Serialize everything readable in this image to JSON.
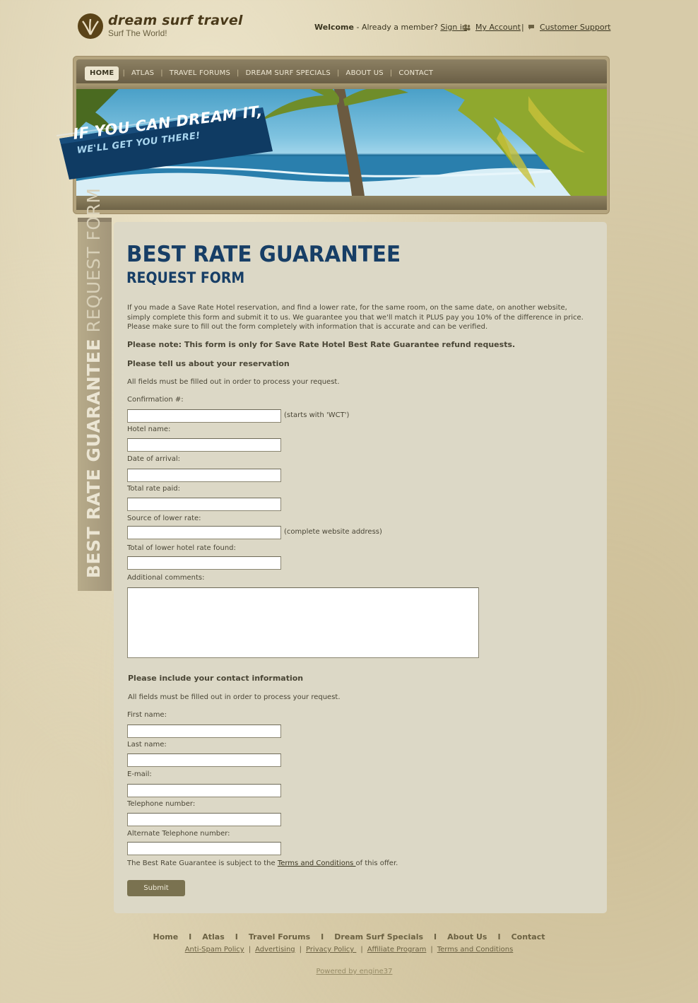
{
  "header": {
    "logo_name": "dream surf travel",
    "logo_tagline": "Surf The World!",
    "welcome_label": "Welcome",
    "welcome_text": " - Already a member? ",
    "sign_in": "Sign in",
    "my_account": "My Account",
    "separator": "|",
    "customer_support": "Customer Support"
  },
  "nav": {
    "items": [
      "HOME",
      "ATLAS",
      "TRAVEL FORUMS",
      "DREAM SURF SPECIALS",
      "ABOUT US",
      "CONTACT"
    ],
    "active": "HOME",
    "separator": "|"
  },
  "banner": {
    "slogan_line1": "IF YOU CAN DREAM IT,",
    "slogan_line2": "WE'LL GET YOU THERE!"
  },
  "sidetab": {
    "bold": "BEST RATE GUARANTEE",
    "light": " REQUEST FORM"
  },
  "page": {
    "title": "BEST RATE GUARANTEE",
    "subtitle": "REQUEST FORM",
    "intro": "If you made a Save Rate Hotel reservation, and find a lower rate, for the same room, on the same date, on another website, simply complete this form and submit it to us. We guarantee you that we'll match it PLUS pay you 10% of the difference in price. Please make sure to fill out the form completely with information that is accurate and can be verified.",
    "note": "Please note: This form is only for Save Rate Hotel Best Rate Guarantee refund requests.",
    "reservation_heading": "Please tell us about your reservation",
    "required_note": "All fields must be filled out in order to process your request.",
    "fields": {
      "confirmation": "Confirmation #:",
      "confirmation_hint": "(starts with 'WCT')",
      "hotel_name": "Hotel name:",
      "date_arrival": "Date of arrival:",
      "total_rate": "Total rate paid:",
      "source_lower": "Source of lower rate:",
      "source_hint": "(complete website address)",
      "total_lower": "Total of lower hotel rate found:",
      "comments": "Additional comments:"
    },
    "contact_heading": "Please include your contact information",
    "contact_required_note": "All fields must be filled out in order to process your request.",
    "contact_fields": {
      "first_name": "First name:",
      "last_name": "Last name:",
      "email": "E-mail:",
      "telephone": "Telephone number:",
      "alt_telephone": "Alternate Telephone number:"
    },
    "terms_pre": "The Best Rate Guarantee is subject to the ",
    "terms_link": "Terms and Conditions ",
    "terms_post": "of this offer.",
    "submit": "Submit"
  },
  "footer": {
    "nav": [
      "Home",
      "Atlas",
      "Travel Forums",
      "Dream Surf Specials",
      "About Us",
      "Contact"
    ],
    "nav_separator": "I",
    "links": [
      "Anti-Spam Policy",
      "Advertising",
      "Privacy Policy ",
      "Affiliate Program",
      "Terms and Conditions"
    ],
    "link_separator": "|",
    "powered": "Powered by engine37"
  },
  "colors": {
    "background": "#d7cba9",
    "panel": "#dcd8c6",
    "title": "#173e66",
    "nav": "#7a6f53",
    "button": "#7a7250"
  }
}
